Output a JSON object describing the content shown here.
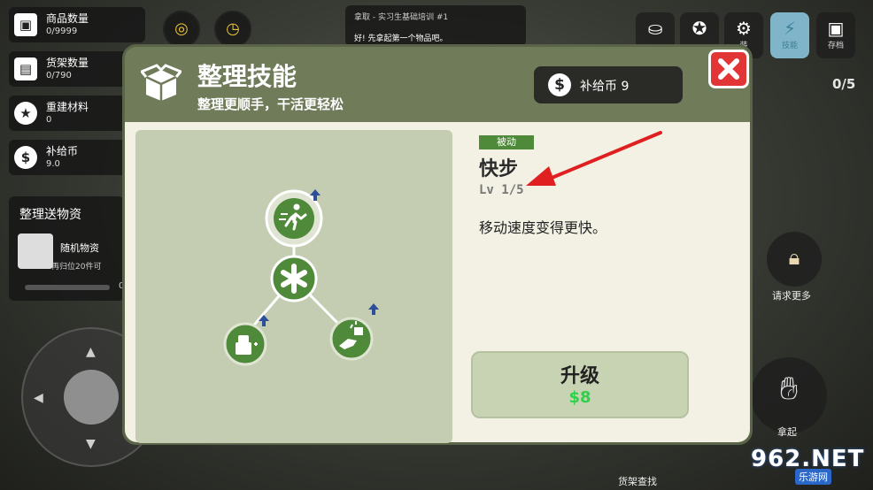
{
  "hud": {
    "stats": [
      {
        "label": "商品数量",
        "value": "0/9999",
        "icon": "box-icon"
      },
      {
        "label": "货架数量",
        "value": "0/790",
        "icon": "shelf-icon"
      },
      {
        "label": "重建材料",
        "value": "0",
        "icon": "star-icon"
      },
      {
        "label": "补给币",
        "value": "9.0",
        "icon": "dollar-icon"
      }
    ],
    "task": {
      "title": "拿取 - 实习生基础培训 #1",
      "text": "好! 先拿起第一个物品吧。"
    },
    "top_buttons": [
      {
        "label": "",
        "icon": "sofa-icon"
      },
      {
        "label": "",
        "icon": "star-badge-icon"
      },
      {
        "label": "装",
        "icon": "gear-icon"
      },
      {
        "label": "技能",
        "icon": "lightning-icon"
      },
      {
        "label": "存档",
        "icon": "save-icon"
      }
    ],
    "counter": "0/5",
    "delivery": {
      "title": "整理送物资",
      "item": "随机物资",
      "desc": "再归位20件可",
      "progress": "0/"
    },
    "request_label": "请求更多",
    "pickup_label": "拿起",
    "shelf_search_label": "货架查找",
    "watermark": "962.NET",
    "watermark_sub": "乐游网"
  },
  "dialog": {
    "title": "整理技能",
    "subtitle": "整理更顺手，干活更轻松",
    "currency": "补给币 9",
    "skill": {
      "tag": "被动",
      "name": "快步",
      "level": "Lv 1/5",
      "level_fraction": 0.2,
      "description": "移动速度变得更快。"
    },
    "upgrade": {
      "label": "升级",
      "price": "$8"
    },
    "colors": {
      "accent": "#4f8a3a",
      "close": "#e23535",
      "price": "#2ed14a",
      "annotation": "#e02020"
    }
  }
}
